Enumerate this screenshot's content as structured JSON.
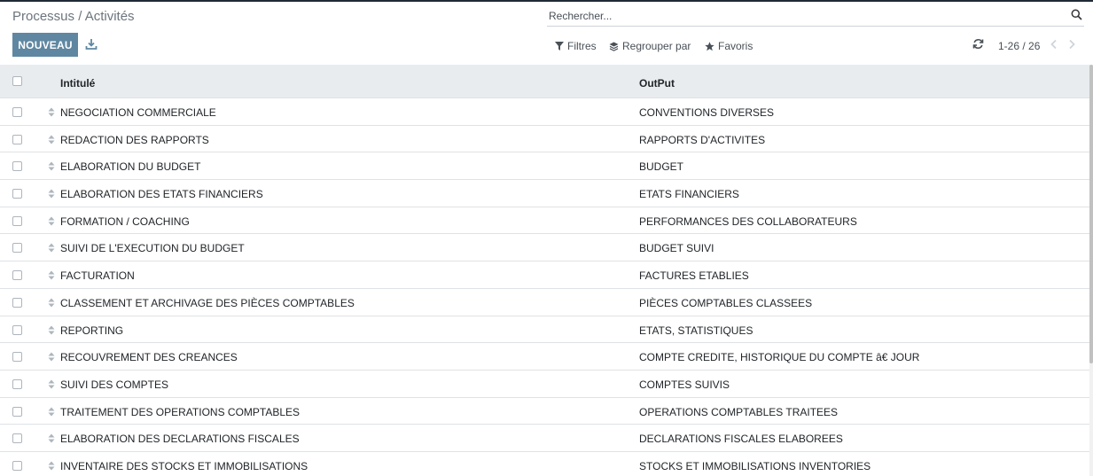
{
  "header": {
    "breadcrumb": "Processus / Activités",
    "new_button": "NOUVEAU",
    "search_placeholder": "Rechercher..."
  },
  "toolbar": {
    "filters_label": "Filtres",
    "group_by_label": "Regrouper par",
    "favorites_label": "Favoris"
  },
  "pager": {
    "value": "1-26 / 26"
  },
  "table": {
    "columns": [
      "Intitulé",
      "OutPut"
    ],
    "rows": [
      {
        "intitule": "NEGOCIATION COMMERCIALE",
        "output": "CONVENTIONS DIVERSES"
      },
      {
        "intitule": "REDACTION DES RAPPORTS",
        "output": "RAPPORTS D'ACTIVITES"
      },
      {
        "intitule": "ELABORATION DU BUDGET",
        "output": "BUDGET"
      },
      {
        "intitule": "ELABORATION DES ETATS FINANCIERS",
        "output": "ETATS FINANCIERS"
      },
      {
        "intitule": "FORMATION / COACHING",
        "output": "PERFORMANCES DES COLLABORATEURS"
      },
      {
        "intitule": "SUIVI DE L'EXECUTION DU BUDGET",
        "output": "BUDGET SUIVI"
      },
      {
        "intitule": "FACTURATION",
        "output": "FACTURES ETABLIES"
      },
      {
        "intitule": "CLASSEMENT ET ARCHIVAGE DES PIÈCES COMPTABLES",
        "output": "PIÈCES COMPTABLES CLASSEES"
      },
      {
        "intitule": "REPORTING",
        "output": "ETATS, STATISTIQUES"
      },
      {
        "intitule": "RECOUVREMENT DES CREANCES",
        "output": "COMPTE CREDITE, HISTORIQUE DU COMPTE â€ JOUR"
      },
      {
        "intitule": "SUIVI DES COMPTES",
        "output": "COMPTES SUIVIS"
      },
      {
        "intitule": "TRAITEMENT DES OPERATIONS COMPTABLES",
        "output": "OPERATIONS COMPTABLES TRAITEES"
      },
      {
        "intitule": "ELABORATION DES DECLARATIONS FISCALES",
        "output": "DECLARATIONS FISCALES ELABOREES"
      },
      {
        "intitule": "INVENTAIRE DES STOCKS ET IMMOBILISATIONS",
        "output": "STOCKS ET IMMOBILISATIONS INVENTORIES"
      }
    ]
  },
  "colors": {
    "primary_button": "#5f87a1",
    "header_background": "#e9ecef"
  },
  "icons": [
    "download-icon",
    "search-icon",
    "filter-icon",
    "layers-icon",
    "star-icon",
    "refresh-icon",
    "chevron-left-icon",
    "chevron-right-icon",
    "drag-handle-icon"
  ]
}
